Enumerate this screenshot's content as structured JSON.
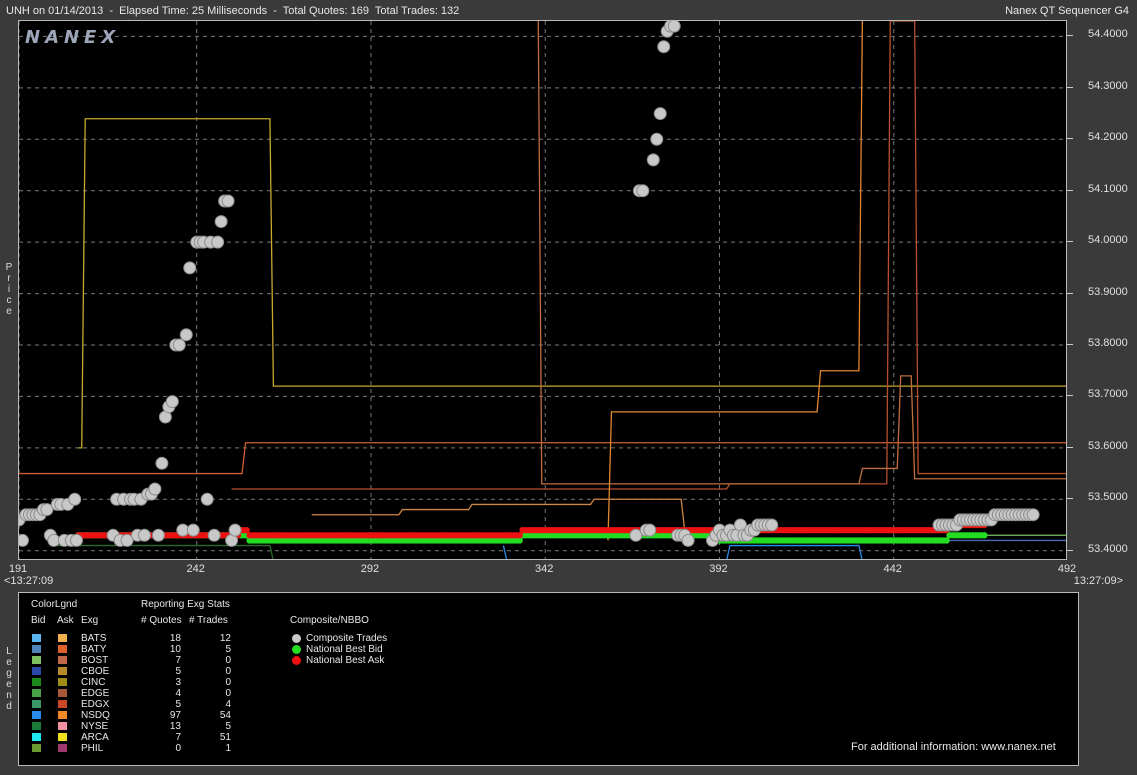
{
  "header": {
    "title_left": "UNH on 01/14/2013  -  Elapsed Time: 25 Milliseconds  -  Total Quotes: 169  Total Trades: 132",
    "title_right": "Nanex QT Sequencer G4"
  },
  "logo": "NANEX",
  "axis": {
    "ylabel": "Price",
    "time_left": "<13:27:09",
    "time_right": "13:27:09>",
    "y_ticks": [
      "54.4000",
      "54.3000",
      "54.2000",
      "54.1000",
      "54.0000",
      "53.9000",
      "53.8000",
      "53.7000",
      "53.6000",
      "53.5000",
      "53.4000"
    ],
    "x_ticks": [
      "191",
      "242",
      "292",
      "342",
      "392",
      "442",
      "492"
    ]
  },
  "legend": {
    "side_label": "Legend",
    "color_header": "ColorLgnd",
    "bid_header": "Bid",
    "ask_header": "Ask",
    "exg_header": "Exg",
    "stats_header": "Reporting Exg Stats",
    "quotes_header": "# Quotes",
    "trades_header": "# Trades",
    "composite_header": "Composite/NBBO",
    "composite_items": [
      {
        "label": "Composite Trades",
        "color": "#c8c8c8"
      },
      {
        "label": "National Best Bid",
        "color": "#22dd22"
      },
      {
        "label": "National Best Ask",
        "color": "#ee1111"
      }
    ],
    "exchanges": [
      {
        "name": "BATS",
        "bid_color": "#5ab4f0",
        "ask_color": "#f0b050",
        "quotes": "18",
        "trades": "12"
      },
      {
        "name": "BATY",
        "bid_color": "#4f82b8",
        "ask_color": "#e0602a",
        "quotes": "10",
        "trades": "5"
      },
      {
        "name": "BOST",
        "bid_color": "#7cc060",
        "ask_color": "#c06848",
        "quotes": "7",
        "trades": "0"
      },
      {
        "name": "CBOE",
        "bid_color": "#2a48a8",
        "ask_color": "#b88a2a",
        "quotes": "5",
        "trades": "0"
      },
      {
        "name": "CINC",
        "bid_color": "#1a8a1a",
        "ask_color": "#a08a18",
        "quotes": "3",
        "trades": "0"
      },
      {
        "name": "EDGE",
        "bid_color": "#48a048",
        "ask_color": "#a85838",
        "quotes": "4",
        "trades": "0"
      },
      {
        "name": "EDGX",
        "bid_color": "#3a9868",
        "ask_color": "#c84828",
        "quotes": "5",
        "trades": "4"
      },
      {
        "name": "NSDQ",
        "bid_color": "#2a8ae8",
        "ask_color": "#f08828",
        "quotes": "97",
        "trades": "54"
      },
      {
        "name": "NYSE",
        "bid_color": "#1a7a38",
        "ask_color": "#f090a0",
        "quotes": "13",
        "trades": "5"
      },
      {
        "name": "ARCA",
        "bid_color": "#20e8f0",
        "ask_color": "#f0e020",
        "quotes": "7",
        "trades": "51"
      },
      {
        "name": "PHIL",
        "bid_color": "#6a9a30",
        "ask_color": "#a03870",
        "quotes": "0",
        "trades": "1"
      }
    ],
    "footer": "For additional information: www.nanex.net"
  },
  "chart_data": {
    "type": "scatter",
    "xlabel": "",
    "ylabel": "Price",
    "xlim": [
      191,
      492
    ],
    "ylim": [
      53.38,
      54.43
    ],
    "grid": true,
    "composite_trades": [
      [
        191,
        53.46
      ],
      [
        192,
        53.42
      ],
      [
        193,
        53.47
      ],
      [
        194,
        53.47
      ],
      [
        195,
        53.47
      ],
      [
        196,
        53.47
      ],
      [
        197,
        53.47
      ],
      [
        198,
        53.48
      ],
      [
        199,
        53.48
      ],
      [
        200,
        53.43
      ],
      [
        201,
        53.42
      ],
      [
        202,
        53.49
      ],
      [
        203,
        53.49
      ],
      [
        204,
        53.42
      ],
      [
        205,
        53.49
      ],
      [
        206,
        53.42
      ],
      [
        207,
        53.5
      ],
      [
        207.5,
        53.42
      ],
      [
        218,
        53.43
      ],
      [
        219,
        53.5
      ],
      [
        220,
        53.42
      ],
      [
        221,
        53.5
      ],
      [
        222,
        53.42
      ],
      [
        223,
        53.5
      ],
      [
        224,
        53.5
      ],
      [
        225,
        53.43
      ],
      [
        226,
        53.5
      ],
      [
        227,
        53.43
      ],
      [
        228,
        53.51
      ],
      [
        229,
        53.51
      ],
      [
        230,
        53.52
      ],
      [
        231,
        53.43
      ],
      [
        232,
        53.57
      ],
      [
        233,
        53.66
      ],
      [
        234,
        53.68
      ],
      [
        235,
        53.69
      ],
      [
        236,
        53.8
      ],
      [
        237,
        53.8
      ],
      [
        238,
        53.44
      ],
      [
        239,
        53.82
      ],
      [
        240,
        53.95
      ],
      [
        241,
        53.44
      ],
      [
        242,
        54.0
      ],
      [
        243,
        54.0
      ],
      [
        244,
        54.0
      ],
      [
        245,
        53.5
      ],
      [
        246,
        54.0
      ],
      [
        247,
        53.43
      ],
      [
        248,
        54.0
      ],
      [
        249,
        54.04
      ],
      [
        250,
        54.08
      ],
      [
        251,
        54.08
      ],
      [
        252,
        53.42
      ],
      [
        253,
        53.44
      ],
      [
        368,
        53.43
      ],
      [
        369,
        54.1
      ],
      [
        370,
        54.1
      ],
      [
        371,
        53.44
      ],
      [
        372,
        53.44
      ],
      [
        373,
        54.16
      ],
      [
        374,
        54.2
      ],
      [
        375,
        54.25
      ],
      [
        376,
        54.38
      ],
      [
        377,
        54.41
      ],
      [
        378,
        54.42
      ],
      [
        379,
        54.42
      ],
      [
        380,
        53.43
      ],
      [
        381,
        53.43
      ],
      [
        382,
        53.43
      ],
      [
        383,
        53.42
      ],
      [
        390,
        53.42
      ],
      [
        391,
        53.43
      ],
      [
        392,
        53.44
      ],
      [
        393,
        53.43
      ],
      [
        394,
        53.43
      ],
      [
        395,
        53.44
      ],
      [
        396,
        53.43
      ],
      [
        397,
        53.43
      ],
      [
        398,
        53.45
      ],
      [
        399,
        53.43
      ],
      [
        400,
        53.43
      ],
      [
        401,
        53.44
      ],
      [
        402,
        53.44
      ],
      [
        403,
        53.45
      ],
      [
        404,
        53.45
      ],
      [
        405,
        53.45
      ],
      [
        406,
        53.45
      ],
      [
        407,
        53.45
      ],
      [
        455,
        53.45
      ],
      [
        456,
        53.45
      ],
      [
        457,
        53.45
      ],
      [
        458,
        53.45
      ],
      [
        459,
        53.45
      ],
      [
        460,
        53.45
      ],
      [
        461,
        53.46
      ],
      [
        462,
        53.46
      ],
      [
        463,
        53.46
      ],
      [
        464,
        53.46
      ],
      [
        465,
        53.46
      ],
      [
        466,
        53.46
      ],
      [
        467,
        53.46
      ],
      [
        468,
        53.46
      ],
      [
        469,
        53.46
      ],
      [
        470,
        53.46
      ],
      [
        471,
        53.47
      ],
      [
        472,
        53.47
      ],
      [
        473,
        53.47
      ],
      [
        474,
        53.47
      ],
      [
        475,
        53.47
      ],
      [
        476,
        53.47
      ],
      [
        477,
        53.47
      ],
      [
        478,
        53.47
      ],
      [
        479,
        53.47
      ],
      [
        480,
        53.47
      ],
      [
        481,
        53.47
      ],
      [
        482,
        53.47
      ]
    ],
    "national_best_bid": [
      [
        208,
        53.43
      ],
      [
        253,
        53.43
      ],
      [
        254,
        53.43
      ],
      [
        257,
        53.42
      ],
      [
        334,
        53.42
      ],
      [
        335,
        53.43
      ],
      [
        388,
        53.43
      ],
      [
        389,
        53.42
      ],
      [
        427,
        53.42
      ],
      [
        428,
        53.42
      ],
      [
        457,
        53.42
      ],
      [
        458,
        53.43
      ],
      [
        468,
        53.43
      ]
    ],
    "national_best_ask": [
      [
        208,
        53.43
      ],
      [
        253,
        53.43
      ],
      [
        254,
        53.44
      ],
      [
        257,
        53.43
      ],
      [
        334,
        53.43
      ],
      [
        335,
        53.44
      ],
      [
        388,
        53.44
      ],
      [
        389,
        53.44
      ],
      [
        427,
        53.44
      ],
      [
        428,
        53.44
      ],
      [
        457,
        53.44
      ],
      [
        458,
        53.45
      ],
      [
        468,
        53.45
      ]
    ],
    "exchange_quote_lines": [
      {
        "exchange": "ARCA",
        "side": "ask",
        "color": "#c8a830",
        "points": [
          [
            208,
            53.6
          ],
          [
            209,
            53.6
          ],
          [
            210,
            54.24
          ],
          [
            263,
            54.24
          ],
          [
            264,
            53.72
          ],
          [
            492,
            53.72
          ]
        ]
      },
      {
        "exchange": "BATY",
        "side": "ask",
        "color": "#d06030",
        "points": [
          [
            190,
            53.54
          ],
          [
            191,
            53.55
          ],
          [
            255,
            53.55
          ],
          [
            256,
            53.61
          ],
          [
            492,
            53.61
          ]
        ]
      },
      {
        "exchange": "EDGX",
        "side": "ask",
        "color": "#b85030",
        "points": [
          [
            252,
            53.52
          ],
          [
            394,
            53.52
          ],
          [
            395,
            53.53
          ],
          [
            440,
            53.53
          ],
          [
            441,
            54.43
          ],
          [
            448,
            54.43
          ],
          [
            449,
            53.55
          ],
          [
            492,
            53.55
          ]
        ]
      },
      {
        "exchange": "BATS",
        "side": "ask",
        "color": "#c07040",
        "points": [
          [
            340,
            54.43
          ],
          [
            341,
            53.53
          ],
          [
            432,
            53.53
          ],
          [
            433,
            53.56
          ],
          [
            443,
            53.56
          ],
          [
            444,
            53.74
          ],
          [
            447,
            53.74
          ],
          [
            448,
            53.54
          ],
          [
            492,
            53.54
          ]
        ]
      },
      {
        "exchange": "NSDQ",
        "side": "ask",
        "color": "#e08830",
        "points": [
          [
            360,
            53.42
          ],
          [
            361,
            53.67
          ],
          [
            420,
            53.67
          ],
          [
            421,
            53.75
          ],
          [
            432,
            53.75
          ],
          [
            433,
            54.43
          ]
        ]
      },
      {
        "exchange": "NYSE",
        "side": "ask",
        "color": "#d08848",
        "points": [
          [
            275,
            53.47
          ],
          [
            300,
            53.47
          ],
          [
            301,
            53.48
          ],
          [
            320,
            53.48
          ],
          [
            321,
            53.49
          ],
          [
            355,
            53.49
          ],
          [
            356,
            53.5
          ],
          [
            381,
            53.5
          ],
          [
            382,
            53.44
          ]
        ]
      },
      {
        "exchange": "EDGE",
        "side": "bid",
        "color": "#2a6a2a",
        "points": [
          [
            202,
            53.41
          ],
          [
            263,
            53.41
          ],
          [
            264,
            53.38
          ]
        ]
      },
      {
        "exchange": "NSDQ",
        "side": "bid",
        "color": "#2a8ae8",
        "points": [
          [
            330,
            53.41
          ],
          [
            331,
            53.38
          ],
          [
            394,
            53.38
          ],
          [
            395,
            53.41
          ],
          [
            432,
            53.41
          ],
          [
            433,
            53.38
          ]
        ]
      },
      {
        "exchange": "CBOE",
        "side": "bid",
        "color": "#4a6ab8",
        "points": [
          [
            440,
            53.42
          ],
          [
            492,
            53.42
          ]
        ]
      },
      {
        "exchange": "BOST",
        "side": "bid",
        "color": "#7cc060",
        "points": [
          [
            460,
            53.43
          ],
          [
            492,
            53.43
          ]
        ]
      }
    ]
  }
}
